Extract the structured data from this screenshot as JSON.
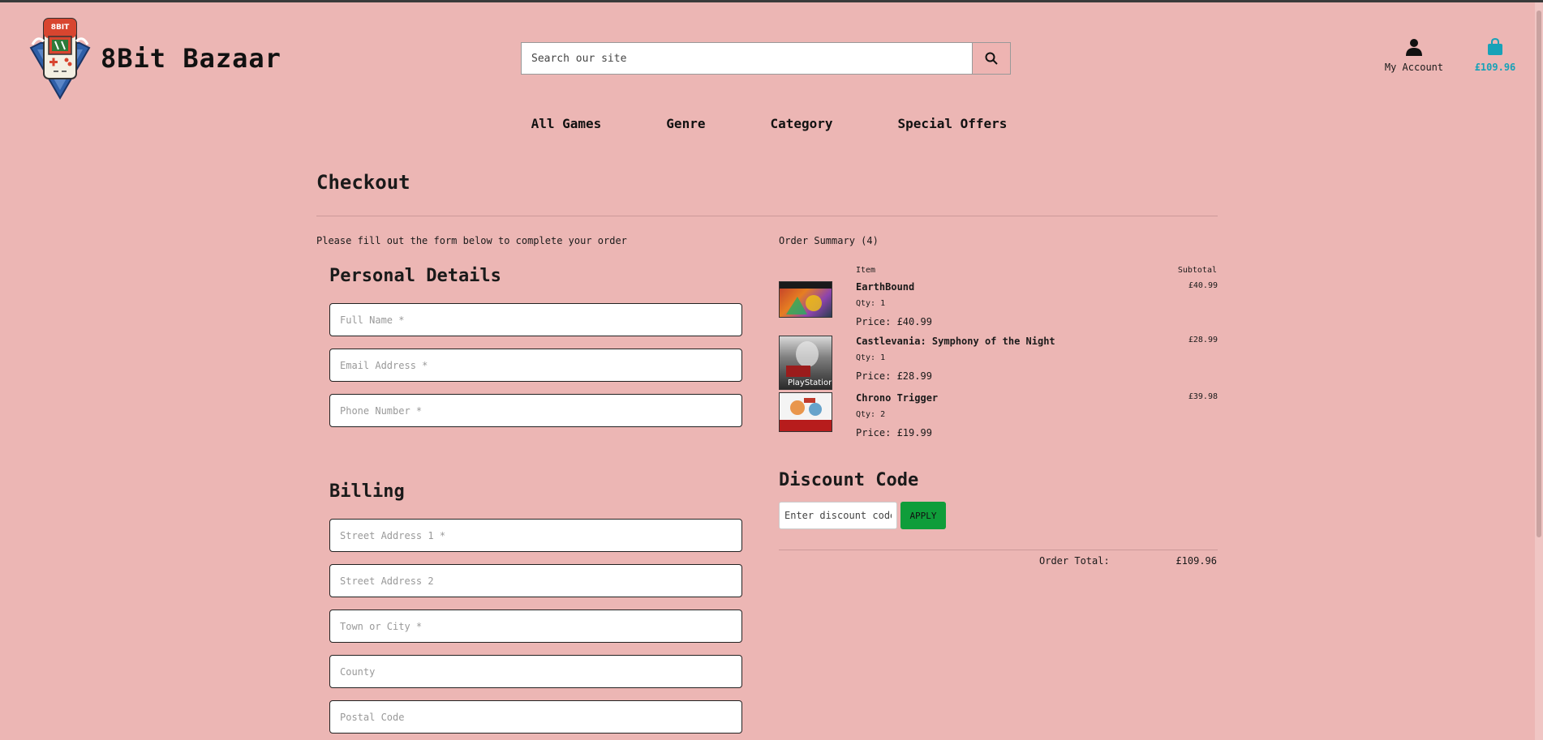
{
  "header": {
    "logo_text": "8BIT",
    "brand": "8Bit Bazaar",
    "search_placeholder": "Search our site",
    "account_label": "My Account",
    "cart_total": "£109.96"
  },
  "nav": [
    "All Games",
    "Genre",
    "Category",
    "Special Offers"
  ],
  "checkout": {
    "title": "Checkout",
    "intro": "Please fill out the form below to complete your order",
    "personal_title": "Personal Details",
    "personal_fields": [
      "Full Name *",
      "Email Address *",
      "Phone Number *"
    ],
    "billing_title": "Billing",
    "billing_fields": [
      "Street Address 1 *",
      "Street Address 2",
      "Town or City *",
      "County",
      "Postal Code"
    ]
  },
  "summary": {
    "heading": "Order Summary (4)",
    "col_item": "Item",
    "col_subtotal": "Subtotal",
    "items": [
      {
        "name": "EarthBound",
        "qty": "Qty: 1",
        "price": "Price: £40.99",
        "subtotal": "£40.99"
      },
      {
        "name": "Castlevania: Symphony of the Night",
        "qty": "Qty: 1",
        "price": "Price: £28.99",
        "subtotal": "£28.99",
        "thumb_caption": "PlayStation"
      },
      {
        "name": "Chrono Trigger",
        "qty": "Qty: 2",
        "price": "Price: £19.99",
        "subtotal": "£39.98"
      }
    ],
    "discount_title": "Discount Code",
    "discount_placeholder": "Enter discount code",
    "apply_label": "APPLY",
    "total_label": "Order Total:",
    "total_value": "£109.96"
  },
  "colors": {
    "background": "#ecb6b4",
    "accent_cart": "#17a2b8",
    "apply_button": "#0f9d3a"
  }
}
